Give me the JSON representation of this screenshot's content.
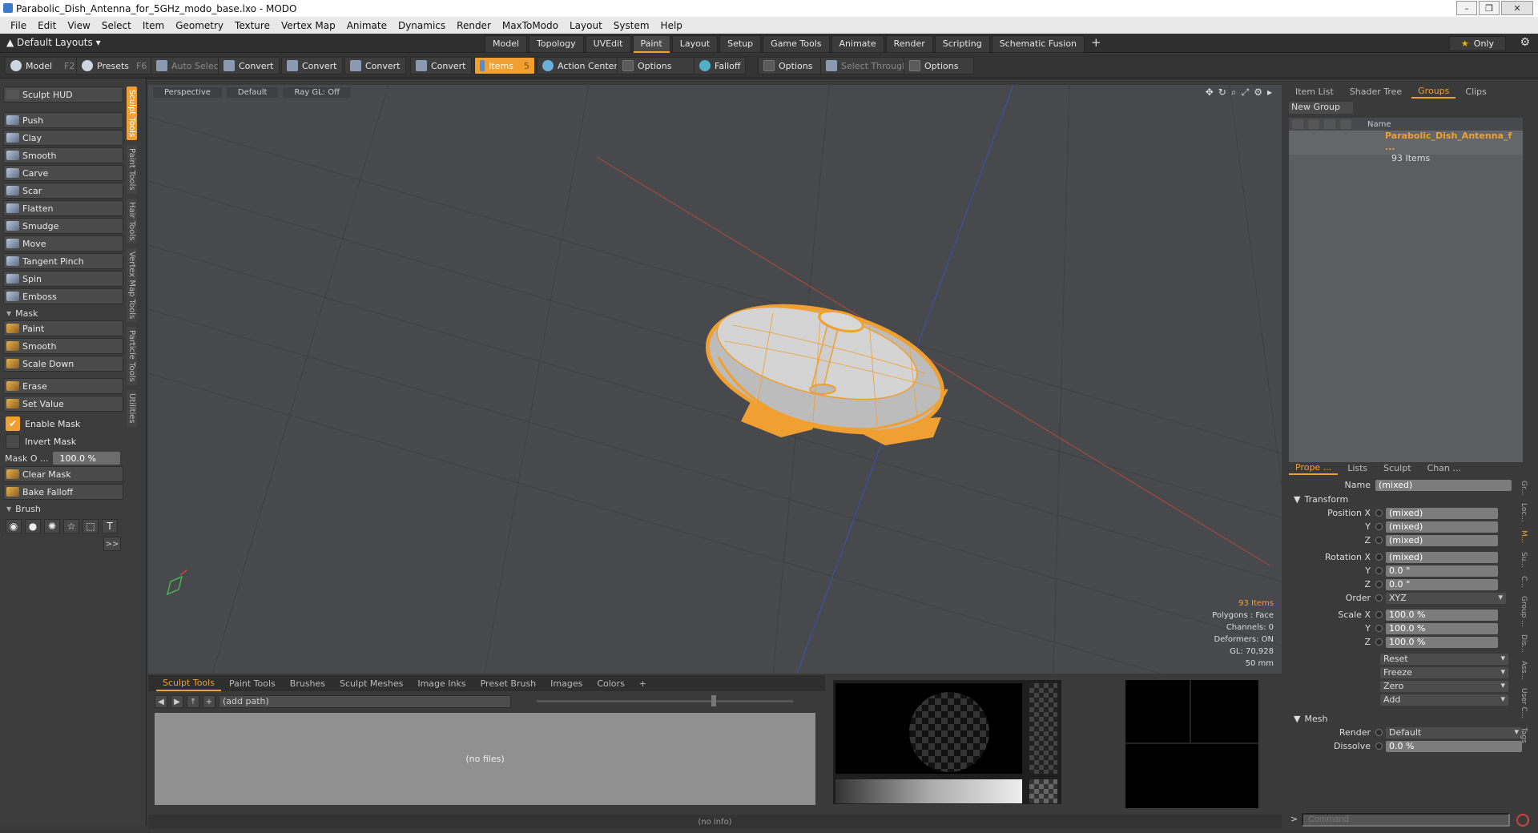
{
  "title": "Parabolic_Dish_Antenna_for_5GHz_modo_base.lxo - MODO",
  "menu": [
    "File",
    "Edit",
    "View",
    "Select",
    "Item",
    "Geometry",
    "Texture",
    "Vertex Map",
    "Animate",
    "Dynamics",
    "Render",
    "MaxToModo",
    "Layout",
    "System",
    "Help"
  ],
  "layout_label": "Default Layouts",
  "layout_tabs": [
    "Model",
    "Topology",
    "UVEdit",
    "Paint",
    "Layout",
    "Setup",
    "Game Tools",
    "Animate",
    "Render",
    "Scripting",
    "Schematic Fusion"
  ],
  "layout_active": "Paint",
  "only_label": "Only",
  "toolbar": {
    "model": "Model",
    "model_key": "F2",
    "presets": "Presets",
    "presets_key": "F6",
    "auto_select": "Auto Select",
    "convert": "Convert",
    "items": "Items",
    "items_key": "5",
    "action_center": "Action Center",
    "options": "Options",
    "falloff": "Falloff",
    "select_through": "Select Through"
  },
  "sculpt": {
    "hud": "Sculpt HUD",
    "tools": [
      "Push",
      "Clay",
      "Smooth",
      "Carve",
      "Scar",
      "Flatten",
      "Smudge",
      "Move",
      "Tangent Pinch",
      "Spin",
      "Emboss"
    ],
    "mask_label": "Mask",
    "mask_tools": [
      "Paint",
      "Smooth",
      "Scale Down"
    ],
    "erase": "Erase",
    "set_value": "Set Value",
    "enable_mask": "Enable Mask",
    "invert_mask": "Invert Mask",
    "mask_o_label": "Mask O ...",
    "mask_o_value": "100.0 %",
    "clear_mask": "Clear Mask",
    "bake_falloff": "Bake Falloff",
    "brush_label": "Brush",
    "more": ">>"
  },
  "side_tabs": [
    "Sculpt Tools",
    "Paint Tools",
    "Hair Tools",
    "Vertex Map Tools",
    "Particle Tools",
    "Utilities"
  ],
  "viewport": {
    "view": "Perspective",
    "shading": "Default",
    "raygl": "Ray GL: Off",
    "info": {
      "items": "93 Items",
      "polygons": "Polygons : Face",
      "channels": "Channels: 0",
      "deformers": "Deformers: ON",
      "gl": "GL: 70,928",
      "scale": "50 mm"
    }
  },
  "bottom_tabs": [
    "Sculpt Tools",
    "Paint Tools",
    "Brushes",
    "Sculpt Meshes",
    "Image Inks",
    "Preset Brush",
    "Images",
    "Colors"
  ],
  "bottom_path": "(add path)",
  "no_files": "(no files)",
  "status": "(no info)",
  "right_tabs": [
    "Item List",
    "Shader Tree",
    "Groups",
    "Clips"
  ],
  "right_active": "Groups",
  "new_group": "New Group",
  "group_header": "Name",
  "group_name": "Parabolic_Dish_Antenna_f ...",
  "group_count": "93 Items",
  "prop_tabs": [
    "Prope ...",
    "Lists",
    "Sculpt",
    "Chan ..."
  ],
  "props": {
    "name_label": "Name",
    "name_value": "(mixed)",
    "transform": "Transform",
    "pos_x": "Position X",
    "pos_x_v": "(mixed)",
    "y": "Y",
    "pos_y_v": "(mixed)",
    "z": "Z",
    "pos_z_v": "(mixed)",
    "rot_x": "Rotation X",
    "rot_x_v": "(mixed)",
    "rot_y_v": "0.0 °",
    "rot_z_v": "0.0 °",
    "order": "Order",
    "order_v": "XYZ",
    "scale_x": "Scale X",
    "scale_x_v": "100.0 %",
    "scale_y_v": "100.0 %",
    "scale_z_v": "100.0 %",
    "reset": "Reset",
    "freeze": "Freeze",
    "zero": "Zero",
    "add": "Add",
    "mesh": "Mesh",
    "render": "Render",
    "render_v": "Default",
    "dissolve": "Dissolve",
    "dissolve_v": "0.0 %"
  },
  "right_side_tabs": [
    "Gr...",
    "Loc...",
    "M...",
    "Su...",
    "C...",
    "Group ...",
    "Dis...",
    "Ass...",
    "User C...",
    "Tags"
  ],
  "command_placeholder": "Command",
  "colors": {
    "accent": "#f0a030",
    "viewport_bg": "#47494d"
  }
}
